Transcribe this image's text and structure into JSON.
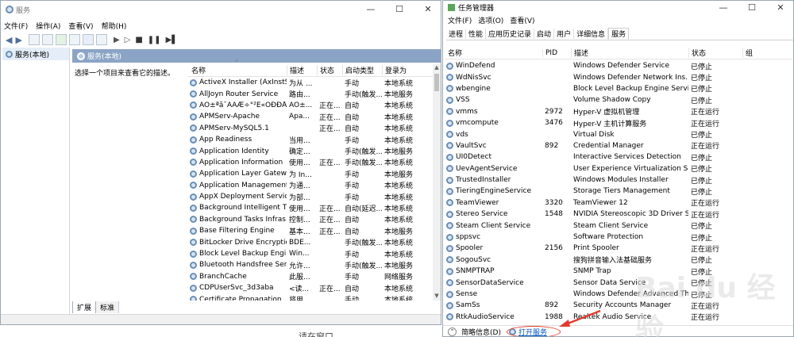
{
  "services_window": {
    "title": "服务",
    "menu": [
      "文件(F)",
      "操作(A)",
      "查看(V)",
      "帮助(H)"
    ],
    "tree_root": "服务(本地)",
    "panel_header": "服务(本地)",
    "hint": "选择一个项目来查看它的描述。",
    "columns": [
      "名称",
      "描述",
      "状态",
      "启动类型",
      "登录为"
    ],
    "rows": [
      [
        "ActiveX Installer (AxInstSV)",
        "为从 ...",
        "",
        "手动",
        "本地系统"
      ],
      [
        "AllJoyn Router Service",
        "路由...",
        "",
        "手动(触发...",
        "本地服务"
      ],
      [
        "ÁÓ±ªã¯ÃÄÆ÷°²È«ÕÐÐÅ",
        "ÁÓ±...",
        "正在...",
        "自动",
        "本地系统"
      ],
      [
        "APMServ-Apache",
        "Apa...",
        "正在...",
        "自动",
        "本地系统"
      ],
      [
        "APMServ-MySQL5.1",
        "",
        "正在...",
        "自动",
        "本地系统"
      ],
      [
        "App Readiness",
        "当用...",
        "",
        "手动",
        "本地系统"
      ],
      [
        "Application Identity",
        "确定...",
        "",
        "手动(触发...",
        "本地服务"
      ],
      [
        "Application Information",
        "使用...",
        "正在...",
        "手动(触发...",
        "本地系统"
      ],
      [
        "Application Layer Gatewa...",
        "为 In...",
        "",
        "手动",
        "本地服务"
      ],
      [
        "Application Management",
        "为通...",
        "",
        "手动",
        "本地系统"
      ],
      [
        "AppX Deployment Servic...",
        "为部...",
        "",
        "手动",
        "本地系统"
      ],
      [
        "Background Intelligent T...",
        "使用...",
        "正在...",
        "自动(延迟...",
        "本地系统"
      ],
      [
        "Background Tasks Infras...",
        "控制...",
        "正在...",
        "自动",
        "本地系统"
      ],
      [
        "Base Filtering Engine",
        "基本...",
        "正在...",
        "自动",
        "本地服务"
      ],
      [
        "BitLocker Drive Encryptio...",
        "BDE...",
        "",
        "手动(触发...",
        "本地系统"
      ],
      [
        "Block Level Backup Engi...",
        "Win...",
        "",
        "手动",
        "本地系统"
      ],
      [
        "Bluetooth Handsfree Serv...",
        "允许...",
        "",
        "手动(触发...",
        "本地服务"
      ],
      [
        "BranchCache",
        "此服...",
        "",
        "手动",
        "网络服务"
      ],
      [
        "CDPUserSvc_3d3aba",
        "<读...",
        "正在...",
        "自动",
        "本地系统"
      ],
      [
        "Certificate Propagation",
        "将用...",
        "",
        "手动",
        "本地系统"
      ]
    ],
    "tabs": [
      "扩展",
      "标准"
    ]
  },
  "task_manager": {
    "title": "任务管理器",
    "menu": [
      "文件(F)",
      "选项(O)",
      "查看(V)"
    ],
    "tabs": [
      "进程",
      "性能",
      "应用历史记录",
      "启动",
      "用户",
      "详细信息",
      "服务"
    ],
    "active_tab": "服务",
    "columns": [
      "名称",
      "PID",
      "描述",
      "状态",
      "组"
    ],
    "rows": [
      [
        "WinDefend",
        "",
        "Windows Defender Service",
        "已停止",
        ""
      ],
      [
        "WdNisSvc",
        "",
        "Windows Defender Network Ins...",
        "已停止",
        ""
      ],
      [
        "wbengine",
        "",
        "Block Level Backup Engine Service",
        "已停止",
        ""
      ],
      [
        "VSS",
        "",
        "Volume Shadow Copy",
        "已停止",
        ""
      ],
      [
        "vmms",
        "2972",
        "Hyper-V 虚拟机管理",
        "正在运行",
        ""
      ],
      [
        "vmcompute",
        "3476",
        "Hyper-V 主机计算服务",
        "正在运行",
        ""
      ],
      [
        "vds",
        "",
        "Virtual Disk",
        "已停止",
        ""
      ],
      [
        "VaultSvc",
        "892",
        "Credential Manager",
        "正在运行",
        ""
      ],
      [
        "UI0Detect",
        "",
        "Interactive Services Detection",
        "已停止",
        ""
      ],
      [
        "UevAgentService",
        "",
        "User Experience Virtualization Se...",
        "已停止",
        ""
      ],
      [
        "TrustedInstaller",
        "",
        "Windows Modules Installer",
        "已停止",
        ""
      ],
      [
        "TieringEngineService",
        "",
        "Storage Tiers Management",
        "已停止",
        ""
      ],
      [
        "TeamViewer",
        "3320",
        "TeamViewer 12",
        "正在运行",
        ""
      ],
      [
        "Stereo Service",
        "1548",
        "NVIDIA Stereoscopic 3D Driver S...",
        "正在运行",
        ""
      ],
      [
        "Steam Client Service",
        "",
        "Steam Client Service",
        "已停止",
        ""
      ],
      [
        "sppsvc",
        "",
        "Software Protection",
        "已停止",
        ""
      ],
      [
        "Spooler",
        "2156",
        "Print Spooler",
        "正在运行",
        ""
      ],
      [
        "SogouSvc",
        "",
        "搜狗拼音输入法基础服务",
        "已停止",
        ""
      ],
      [
        "SNMPTRAP",
        "",
        "SNMP Trap",
        "已停止",
        ""
      ],
      [
        "SensorDataService",
        "",
        "Sensor Data Service",
        "已停止",
        ""
      ],
      [
        "Sense",
        "",
        "Windows Defender Advanced Th...",
        "已停止",
        ""
      ],
      [
        "SamSs",
        "892",
        "Security Accounts Manager",
        "正在运行",
        ""
      ],
      [
        "RtkAudioService",
        "1988",
        "Realtek Audio Service",
        "正在运行",
        ""
      ]
    ],
    "footer_summary": "简略信息(D)",
    "footer_link": "打开服务"
  },
  "background_text": "请在窗口"
}
